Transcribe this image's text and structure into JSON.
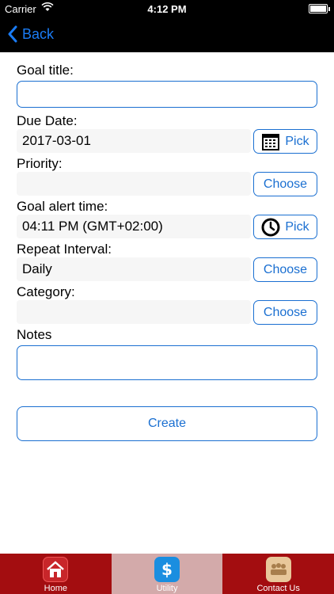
{
  "status_bar": {
    "carrier": "Carrier",
    "time": "4:12 PM"
  },
  "nav": {
    "back_label": "Back"
  },
  "form": {
    "goal_title_label": "Goal title:",
    "goal_title_value": "",
    "due_date_label": "Due Date:",
    "due_date_value": "2017-03-01",
    "due_date_button": "Pick",
    "priority_label": "Priority:",
    "priority_value": "",
    "priority_button": "Choose",
    "alert_time_label": "Goal alert time:",
    "alert_time_value": "04:11 PM (GMT+02:00)",
    "alert_time_button": "Pick",
    "repeat_label": "Repeat Interval:",
    "repeat_value": "Daily",
    "repeat_button": "Choose",
    "category_label": "Category:",
    "category_value": "",
    "category_button": "Choose",
    "notes_label": "Notes",
    "notes_value": "",
    "create_button": "Create"
  },
  "tabs": [
    {
      "label": "Home",
      "icon": "home-icon",
      "active": false
    },
    {
      "label": "Utility",
      "icon": "dollar-icon",
      "active": true
    },
    {
      "label": "Contact Us",
      "icon": "contacts-icon",
      "active": false
    }
  ],
  "colors": {
    "accent": "#1a6fd1",
    "tabbar": "#a30d10",
    "tab_active": "#d3aaaa"
  }
}
